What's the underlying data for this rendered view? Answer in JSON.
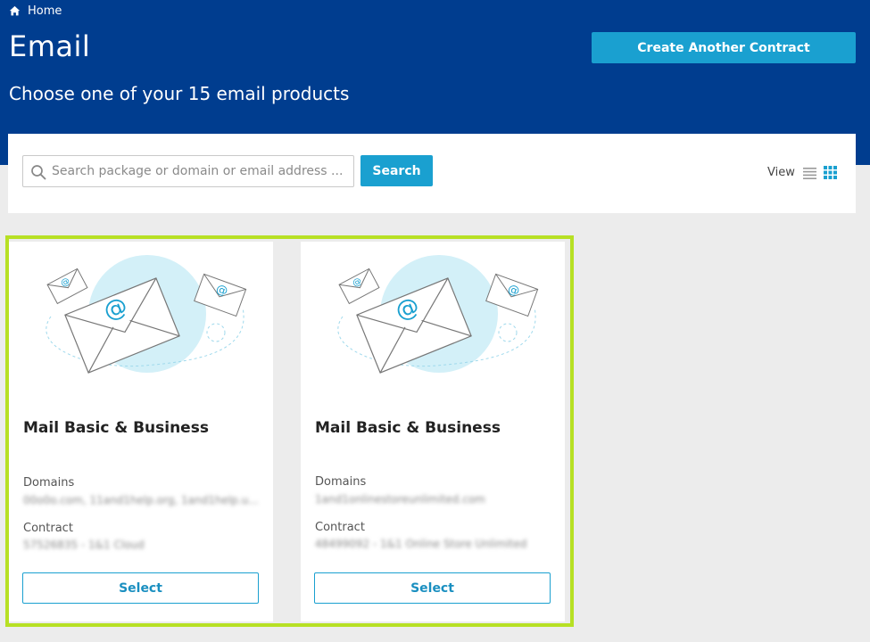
{
  "breadcrumb": {
    "home_label": "Home"
  },
  "header": {
    "title": "Email",
    "subtitle": "Choose one of your 15 email products",
    "create_button_label": "Create Another Contract"
  },
  "search": {
    "placeholder": "Search package or domain or email address ...",
    "value": "",
    "button_label": "Search",
    "view_label": "View",
    "active_view": "grid"
  },
  "products": [
    {
      "title": "Mail Basic & Business",
      "domains_label": "Domains",
      "domains_value": "00o0o.com, 11and1help.org, 1and1help.u...",
      "contract_label": "Contract",
      "contract_value": "57526835 - 1&1 Cloud",
      "select_label": "Select"
    },
    {
      "title": "Mail Basic & Business",
      "domains_label": "Domains",
      "domains_value": "1and1onlinestoreunlimited.com",
      "contract_label": "Contract",
      "contract_value": "48499092 - 1&1 Online Store Unlimited",
      "select_label": "Select"
    }
  ],
  "colors": {
    "header_bg": "#003d8f",
    "accent": "#1aa0d0",
    "highlight": "#b7e024",
    "page_bg": "#ececec"
  }
}
